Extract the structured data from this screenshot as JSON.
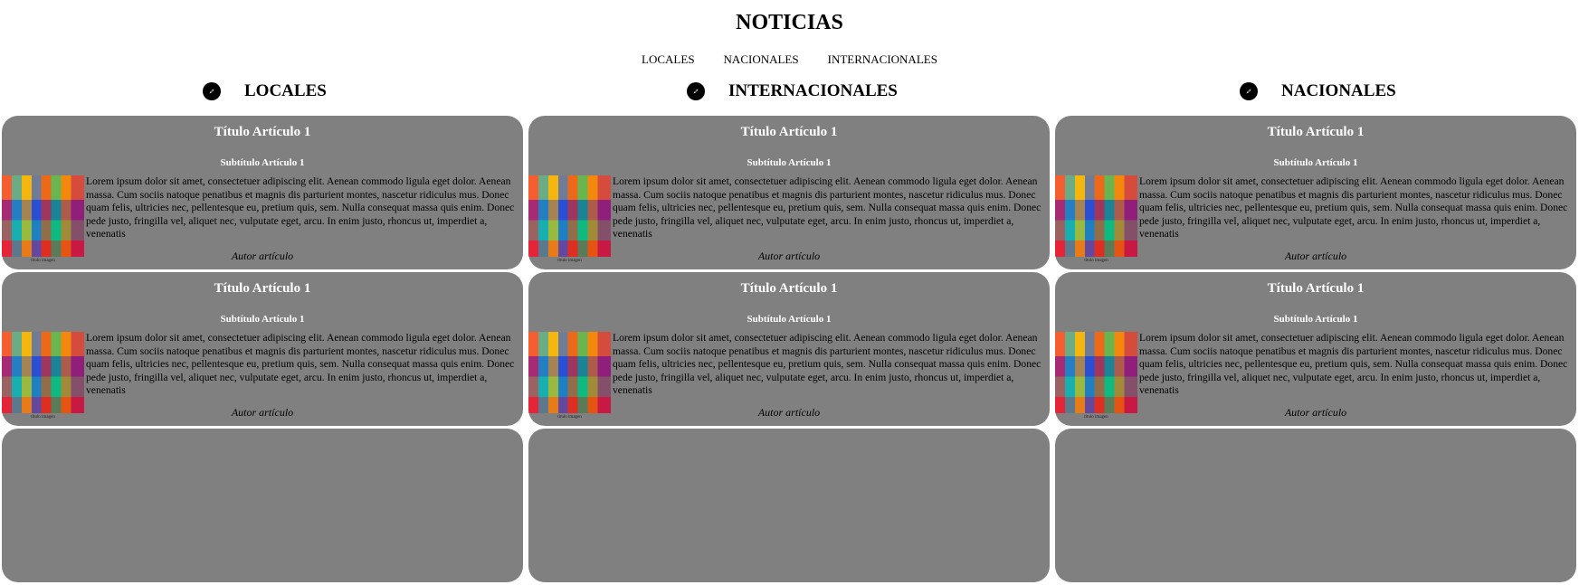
{
  "header": {
    "title": "NOTICIAS"
  },
  "nav": [
    {
      "label": "LOCALES"
    },
    {
      "label": "NACIONALES"
    },
    {
      "label": "INTERNACIONALES"
    }
  ],
  "sections": [
    {
      "heading": "LOCALES",
      "icon": "compass-icon"
    },
    {
      "heading": "INTERNACIONALES",
      "icon": "compass-icon"
    },
    {
      "heading": "NACIONALES",
      "icon": "compass-icon"
    }
  ],
  "article": {
    "title": "Título Artículo 1",
    "subtitle": "Subtítulo Artículo 1",
    "body": "Lorem ipsum dolor sit amet, consectetuer adipiscing elit. Aenean commodo ligula eget dolor. Aenean massa. Cum sociis natoque penatibus et magnis dis parturient montes, nascetur ridiculus mus. Donec quam felis, ultricies nec, pellentesque eu, pretium quis, sem. Nulla consequat massa quis enim. Donec pede justo, fringilla vel, aliquet nec, vulputate eget, arcu. In enim justo, rhoncus ut, imperdiet a, venenatis",
    "image_caption": "título imagen",
    "author": "Autor artículo"
  },
  "colors": {
    "card_bg": "#808080",
    "card_heading": "#ffffff"
  }
}
